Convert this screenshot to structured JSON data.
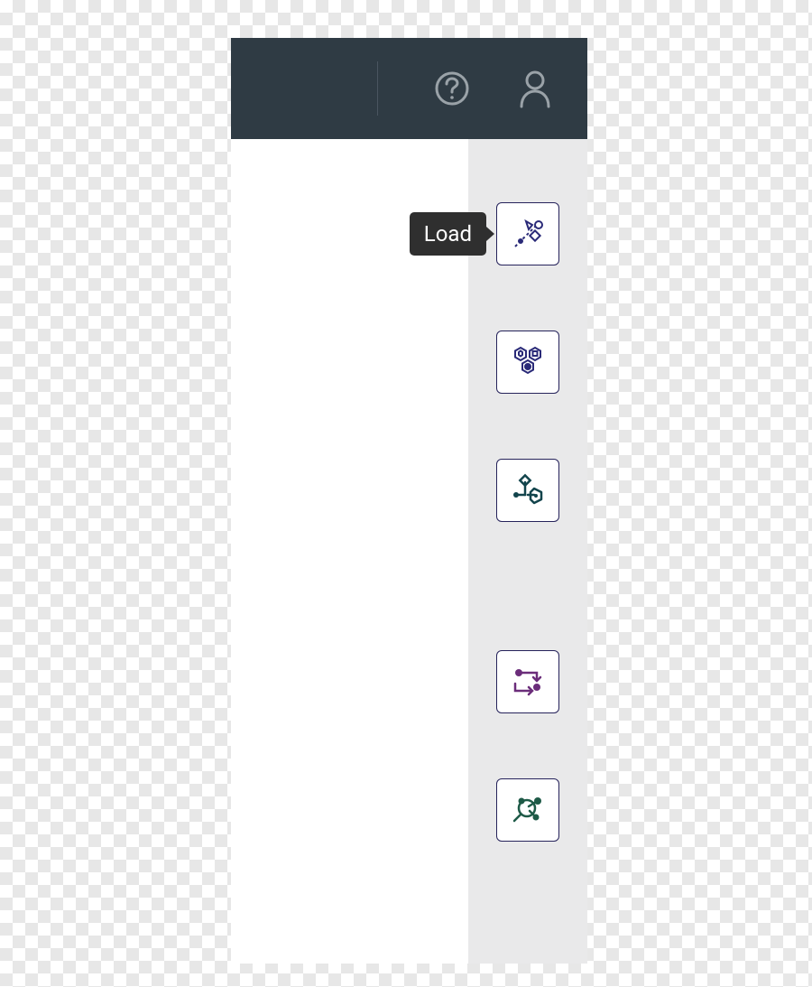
{
  "header": {
    "help_icon": "help-icon",
    "user_icon": "user-icon"
  },
  "tooltip": {
    "load": "Load"
  },
  "rail": {
    "items": [
      {
        "name": "load-button",
        "icon": "load-icon",
        "color": "#2a2a78"
      },
      {
        "name": "modules-button",
        "icon": "modules-icon",
        "color": "#2a2a78"
      },
      {
        "name": "transform-button",
        "icon": "transform-icon",
        "color": "#12444c"
      },
      {
        "name": "sequence-button",
        "icon": "sequence-icon",
        "color": "#6b2d7a"
      },
      {
        "name": "inspect-button",
        "icon": "inspect-icon",
        "color": "#1e5a47"
      }
    ]
  }
}
